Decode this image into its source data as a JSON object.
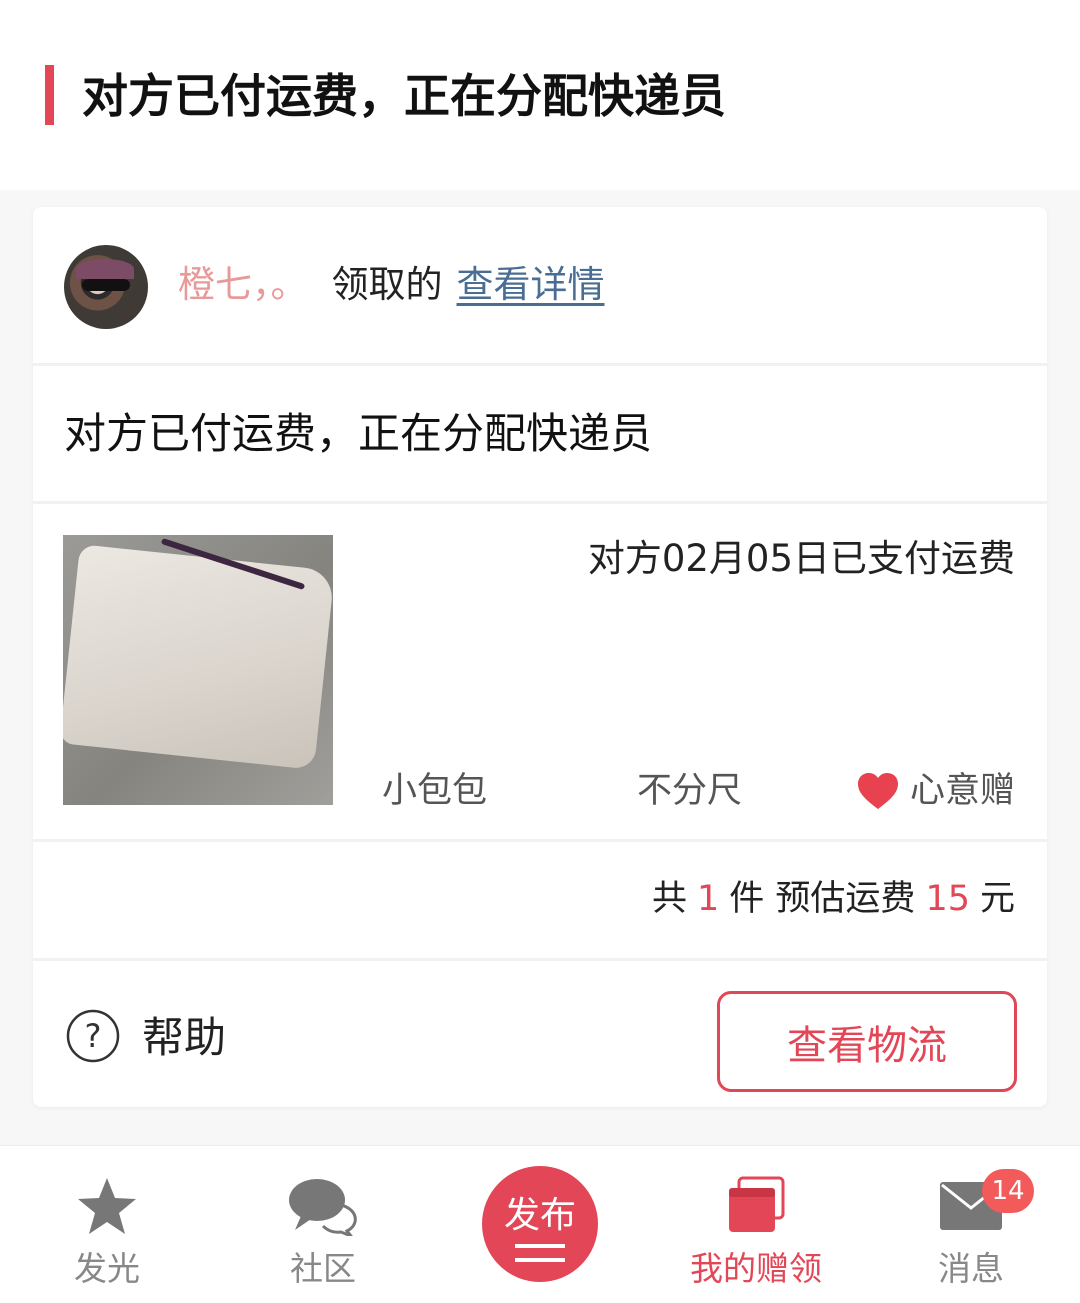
{
  "header": {
    "title": "对方已付运费，正在分配快递员"
  },
  "order": {
    "user_name": "橙七，。",
    "claimed_label": "领取的",
    "details_link": "查看详情",
    "status": "对方已付运费，正在分配快递员",
    "pay_info": "对方02月05日已支付运费",
    "item_name": "小包包",
    "item_size": "不分尺",
    "gift_type": "心意赠",
    "summary": {
      "prefix": "共",
      "count": "1",
      "mid": "件 预估运费",
      "fee": "15",
      "unit": "元"
    },
    "help_label": "帮助",
    "logistics_button": "查看物流"
  },
  "tabbar": {
    "items": [
      {
        "label": "发光",
        "icon": "star-icon"
      },
      {
        "label": "社区",
        "icon": "chat-bubbles-icon"
      },
      {
        "label": "发布",
        "icon": "publish-icon"
      },
      {
        "label": "我的赠领",
        "icon": "cards-icon"
      },
      {
        "label": "消息",
        "icon": "mail-icon"
      }
    ],
    "active": "我的赠领",
    "message_badge": "14"
  },
  "colors": {
    "accent": "#e34656",
    "link": "#4a6e93",
    "user_name": "#e89a9a",
    "badge": "#f35b5b"
  }
}
